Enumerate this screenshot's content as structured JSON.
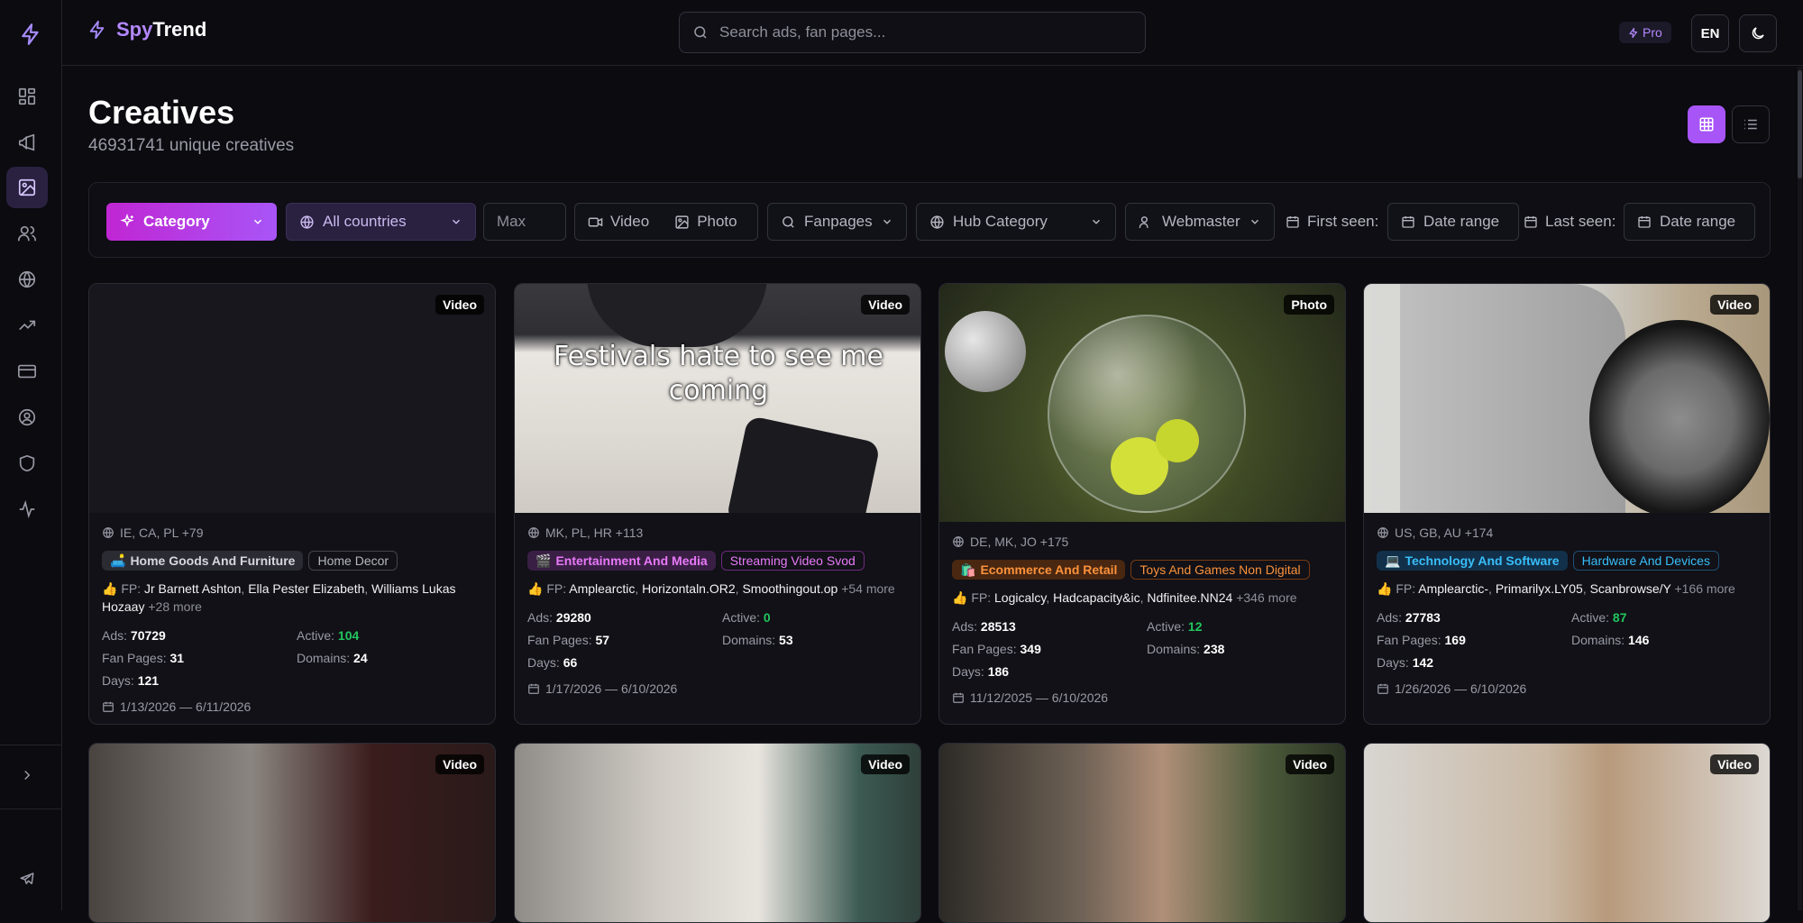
{
  "brand": {
    "name_a": "Spy",
    "name_b": "Trend"
  },
  "search": {
    "placeholder": "Search ads, fan pages..."
  },
  "topbar": {
    "pro_label": "Pro",
    "lang": "EN"
  },
  "page": {
    "title": "Creatives",
    "subtitle": "46931741 unique creatives"
  },
  "sidebar": {
    "items": [
      {
        "name": "dashboard",
        "icon": "grid-icon"
      },
      {
        "name": "ads",
        "icon": "megaphone-icon"
      },
      {
        "name": "creatives",
        "icon": "image-icon",
        "active": true
      },
      {
        "name": "users",
        "icon": "users-icon"
      },
      {
        "name": "globe",
        "icon": "globe-icon"
      },
      {
        "name": "trends",
        "icon": "trending-up-icon"
      },
      {
        "name": "billing",
        "icon": "credit-card-icon"
      },
      {
        "name": "account",
        "icon": "user-circle-icon"
      },
      {
        "name": "security",
        "icon": "shield-icon"
      },
      {
        "name": "activity",
        "icon": "activity-icon"
      }
    ]
  },
  "filters": {
    "category": "Category",
    "countries": "All countries",
    "max_placeholder": "Max",
    "video": "Video",
    "photo": "Photo",
    "fanpages": "Fanpages",
    "hub_category": "Hub Category",
    "webmaster": "Webmaster",
    "first_seen_label": "First seen:",
    "first_seen_value": "Date range",
    "last_seen_label": "Last seen:",
    "last_seen_value": "Date range"
  },
  "stat_labels": {
    "ads": "Ads:",
    "active": "Active:",
    "fan_pages": "Fan Pages:",
    "domains": "Domains:",
    "days": "Days:",
    "fp": "FP:"
  },
  "cards": [
    {
      "type": "Video",
      "geo": "IE, CA, PL +79",
      "tag1": "Home Goods And Furniture",
      "tag1_emoji": "🛋️",
      "tag2": "Home Decor",
      "fp": [
        "Jr Barnett Ashton",
        "Ella Pester Elizabeth",
        "Williams Lukas Hozaay"
      ],
      "fp_more": "+28 more",
      "ads": "70729",
      "active": "104",
      "fan_pages": "31",
      "domains": "24",
      "days": "121",
      "range": "1/13/2026 — 6/11/2026"
    },
    {
      "type": "Video",
      "geo": "MK, PL, HR +113",
      "tag1": "Entertainment And Media",
      "tag1_emoji": "🎬",
      "tag2": "Streaming Video Svod",
      "fp": [
        "Amplearctic",
        "Horizontaln.OR2",
        "Smoothingout.op"
      ],
      "fp_more": "+54 more",
      "ads": "29280",
      "active": "0",
      "fan_pages": "57",
      "domains": "53",
      "days": "66",
      "range": "1/17/2026 — 6/10/2026",
      "overlay": "Festivals hate to see me coming"
    },
    {
      "type": "Photo",
      "geo": "DE, MK, JO +175",
      "tag1": "Ecommerce And Retail",
      "tag1_emoji": "🛍️",
      "tag2": "Toys And Games Non Digital",
      "fp": [
        "Logicalcy",
        "Hadcapacity&ic",
        "Ndfinitee.NN24"
      ],
      "fp_more": "+346 more",
      "ads": "28513",
      "active": "12",
      "fan_pages": "349",
      "domains": "238",
      "days": "186",
      "range": "11/12/2025 — 6/10/2026"
    },
    {
      "type": "Video",
      "geo": "US, GB, AU +174",
      "tag1": "Technology And Software",
      "tag1_emoji": "💻",
      "tag2": "Hardware And Devices",
      "fp": [
        "Amplearctic-",
        "Primarilyx.LY05",
        "Scanbrowse/Y"
      ],
      "fp_more": "+166 more",
      "ads": "27783",
      "active": "87",
      "fan_pages": "169",
      "domains": "146",
      "days": "142",
      "range": "1/26/2026 — 6/10/2026"
    }
  ],
  "row2": [
    {
      "type": "Video"
    },
    {
      "type": "Video"
    },
    {
      "type": "Video"
    },
    {
      "type": "Video"
    }
  ],
  "colors": {
    "accent": "#a855f7",
    "active_green": "#22c55e"
  }
}
